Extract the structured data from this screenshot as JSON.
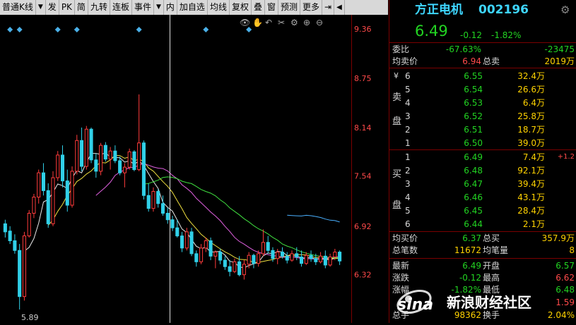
{
  "toolbar": {
    "items": [
      "普通K线",
      "发",
      "PK",
      "简",
      "九转",
      "连板",
      "事件",
      "内",
      "加自选",
      "均线",
      "复权",
      "叠",
      "窗",
      "预测",
      "更多"
    ]
  },
  "chart_data": {
    "type": "candlestick",
    "y_ticks": [
      "9.36",
      "8.75",
      "8.14",
      "7.54",
      "6.92",
      "6.32"
    ],
    "bottom_label": "5.89",
    "y_range": [
      5.89,
      9.36
    ],
    "candles": [
      [
        6.95,
        7.0,
        6.78,
        6.85
      ],
      [
        6.86,
        6.92,
        6.7,
        6.74
      ],
      [
        6.74,
        6.82,
        6.58,
        6.62
      ],
      [
        6.62,
        6.7,
        5.89,
        6.05
      ],
      [
        6.05,
        6.85,
        6.0,
        6.8
      ],
      [
        6.8,
        7.12,
        6.78,
        7.08
      ],
      [
        7.08,
        7.32,
        7.02,
        7.28
      ],
      [
        7.28,
        7.62,
        7.2,
        7.58
      ],
      [
        7.58,
        7.7,
        7.3,
        7.36
      ],
      [
        7.36,
        7.45,
        6.9,
        6.95
      ],
      [
        6.95,
        7.6,
        6.92,
        7.52
      ],
      [
        7.52,
        7.85,
        7.48,
        7.8
      ],
      [
        7.8,
        7.92,
        7.4,
        7.48
      ],
      [
        7.48,
        7.62,
        7.1,
        7.18
      ],
      [
        7.18,
        7.66,
        7.15,
        7.6
      ],
      [
        7.6,
        8.05,
        7.56,
        7.98
      ],
      [
        7.98,
        8.14,
        7.6,
        7.66
      ],
      [
        7.66,
        8.16,
        7.62,
        8.12
      ],
      [
        8.12,
        8.14,
        7.7,
        7.74
      ],
      [
        7.74,
        7.82,
        7.52,
        7.6
      ],
      [
        7.6,
        7.95,
        7.55,
        7.92
      ],
      [
        7.92,
        7.96,
        7.72,
        7.75
      ],
      [
        7.75,
        7.9,
        7.62,
        7.85
      ],
      [
        7.85,
        7.92,
        7.7,
        7.73
      ],
      [
        7.73,
        7.78,
        7.55,
        7.58
      ],
      [
        7.58,
        7.7,
        7.4,
        7.65
      ],
      [
        7.65,
        7.88,
        7.62,
        7.84
      ],
      [
        7.84,
        7.86,
        7.6,
        7.62
      ],
      [
        7.62,
        8.55,
        7.6,
        7.95
      ],
      [
        7.95,
        7.98,
        7.25,
        7.3
      ],
      [
        7.3,
        7.45,
        7.1,
        7.14
      ],
      [
        7.14,
        7.4,
        7.1,
        7.35
      ],
      [
        7.35,
        7.38,
        7.15,
        7.2
      ],
      [
        7.2,
        7.3,
        7.05,
        7.08
      ],
      [
        7.08,
        7.15,
        6.95,
        7.0
      ],
      [
        7.0,
        7.05,
        6.86,
        6.9
      ],
      [
        6.9,
        7.0,
        6.78,
        6.8
      ],
      [
        6.8,
        6.85,
        6.6,
        6.65
      ],
      [
        6.65,
        6.9,
        6.62,
        6.85
      ],
      [
        6.85,
        6.9,
        6.55,
        6.58
      ],
      [
        6.58,
        6.62,
        6.42,
        6.48
      ],
      [
        6.48,
        6.7,
        6.45,
        6.65
      ],
      [
        6.65,
        6.78,
        6.6,
        6.74
      ],
      [
        6.74,
        6.78,
        6.5,
        6.55
      ],
      [
        6.55,
        6.62,
        6.4,
        6.6
      ],
      [
        6.6,
        6.64,
        6.45,
        6.5
      ],
      [
        6.5,
        6.55,
        6.38,
        6.42
      ],
      [
        6.42,
        6.5,
        6.3,
        6.36
      ],
      [
        6.36,
        6.52,
        6.34,
        6.48
      ],
      [
        6.48,
        6.55,
        6.3,
        6.32
      ],
      [
        6.32,
        6.5,
        6.26,
        6.45
      ],
      [
        6.45,
        6.6,
        6.4,
        6.56
      ],
      [
        6.56,
        6.58,
        6.4,
        6.46
      ],
      [
        6.46,
        6.62,
        6.42,
        6.58
      ],
      [
        6.58,
        6.88,
        6.55,
        6.72
      ],
      [
        6.72,
        6.8,
        6.58,
        6.62
      ],
      [
        6.62,
        6.66,
        6.48,
        6.52
      ],
      [
        6.52,
        6.64,
        6.45,
        6.6
      ],
      [
        6.6,
        6.66,
        6.52,
        6.55
      ],
      [
        6.55,
        6.6,
        6.46,
        6.5
      ],
      [
        6.5,
        6.62,
        6.48,
        6.58
      ],
      [
        6.58,
        6.66,
        6.5,
        6.54
      ],
      [
        6.54,
        6.62,
        6.42,
        6.46
      ],
      [
        6.46,
        6.6,
        6.44,
        6.56
      ],
      [
        6.56,
        6.62,
        6.48,
        6.52
      ],
      [
        6.52,
        6.58,
        6.44,
        6.48
      ],
      [
        6.48,
        6.6,
        6.46,
        6.55
      ],
      [
        6.55,
        6.62,
        6.4,
        6.44
      ],
      [
        6.44,
        6.58,
        6.42,
        6.54
      ],
      [
        6.54,
        6.64,
        6.5,
        6.6
      ],
      [
        6.6,
        6.62,
        6.44,
        6.49
      ]
    ],
    "marker_days": [
      1,
      3,
      11,
      15,
      28,
      42,
      51
    ]
  },
  "quote": {
    "name": "方正电机",
    "code": "002196",
    "price": "6.49",
    "change": "-0.12",
    "change_pct": "-1.82%",
    "weibi_label": "委比",
    "weibi_pct": "-67.63%",
    "weibi_val": "-23475",
    "avg_sell_label": "均卖价",
    "avg_sell": "6.94",
    "total_sell_label": "总卖",
    "total_sell": "2019万",
    "sell_side_label": "卖盘",
    "asks": [
      {
        "lvl": "6",
        "price": "6.55",
        "vol": "32.4万"
      },
      {
        "lvl": "5",
        "price": "6.54",
        "vol": "26.6万"
      },
      {
        "lvl": "4",
        "price": "6.53",
        "vol": "6.4万"
      },
      {
        "lvl": "3",
        "price": "6.52",
        "vol": "25.8万"
      },
      {
        "lvl": "2",
        "price": "6.51",
        "vol": "18.7万"
      },
      {
        "lvl": "1",
        "price": "6.50",
        "vol": "39.0万"
      }
    ],
    "buy_side_label": "买盘",
    "bids": [
      {
        "lvl": "1",
        "price": "6.49",
        "vol": "7.4万",
        "extra": "+1.2"
      },
      {
        "lvl": "2",
        "price": "6.48",
        "vol": "92.1万",
        "extra": ""
      },
      {
        "lvl": "3",
        "price": "6.47",
        "vol": "39.4万",
        "extra": ""
      },
      {
        "lvl": "4",
        "price": "6.46",
        "vol": "43.1万",
        "extra": ""
      },
      {
        "lvl": "5",
        "price": "6.45",
        "vol": "28.4万",
        "extra": ""
      },
      {
        "lvl": "6",
        "price": "6.44",
        "vol": "2.1万",
        "extra": ""
      }
    ],
    "avg_buy_label": "均买价",
    "avg_buy": "6.37",
    "total_buy_label": "总买",
    "total_buy": "357.9万",
    "total_trades_label": "总笔数",
    "total_trades": "11672",
    "avg_per_trade_label": "均笔量",
    "avg_per_trade": "8",
    "latest_label": "最新",
    "latest": "6.49",
    "open_label": "开盘",
    "open": "6.57",
    "chg_label": "涨跌",
    "chg": "-0.12",
    "high_label": "最高",
    "high": "6.62",
    "chgpct_label": "涨幅",
    "chgpct": "-1.82%",
    "low_label": "最低",
    "low": "6.48",
    "lb_value": "1.59",
    "vol_label": "总手",
    "vol": "98362",
    "turnover_label": "换手",
    "turnover": "2.04%"
  },
  "watermark": {
    "logo": "sina",
    "text": "新浪财经社区"
  }
}
